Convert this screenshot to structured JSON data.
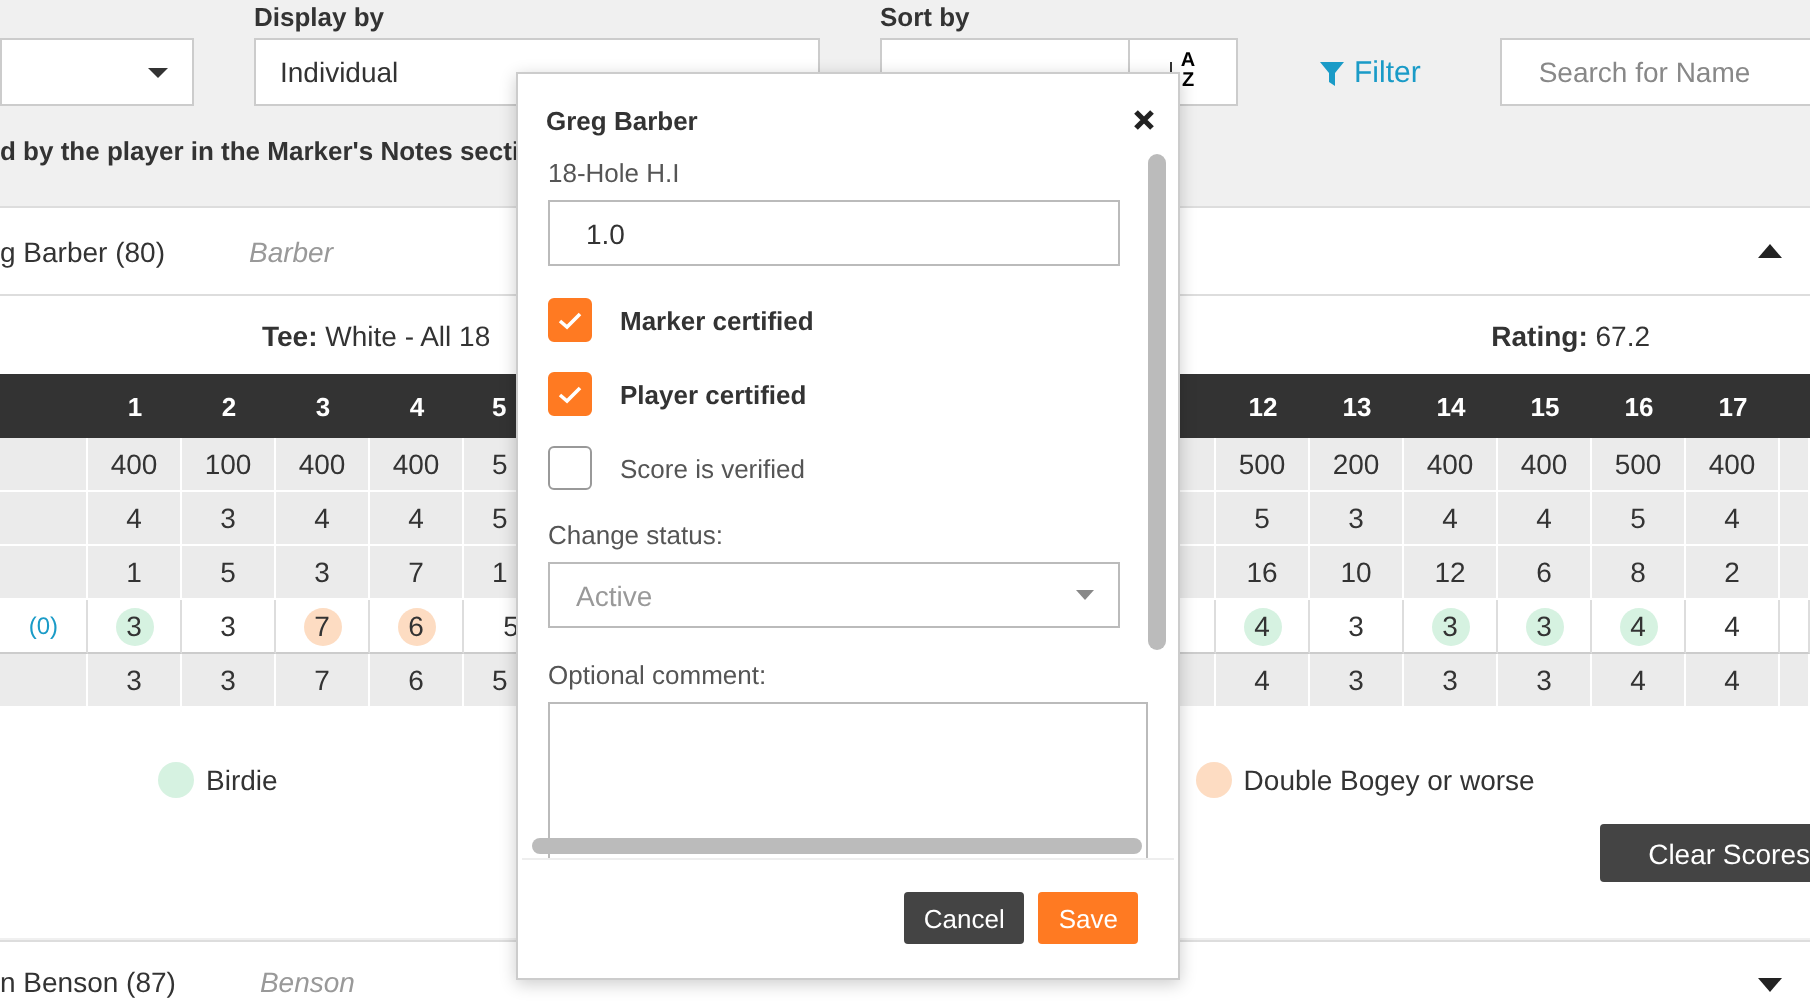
{
  "display_by": {
    "label": "Display by",
    "value": "Individual"
  },
  "sort_by": {
    "label": "Sort by",
    "order_top": "A",
    "order_bottom": "Z"
  },
  "filter": {
    "label": "Filter"
  },
  "search": {
    "placeholder": "Search for Name"
  },
  "note": "d by the player in the Marker's Notes secti",
  "players": [
    {
      "name": "g Barber (80)",
      "short_name": "Barber",
      "expanded": true
    },
    {
      "name": "n Benson (87)",
      "short_name": "Benson",
      "expanded": false
    }
  ],
  "scorecard": {
    "tee_label": "Tee:",
    "tee": "White - All 18",
    "rating_label": "Rating:",
    "rating": "67.2",
    "score_total": "(0)",
    "front_holes": [
      {
        "hole": "1",
        "yards": "400",
        "par": "4",
        "index": "1",
        "score": "3",
        "net": "3",
        "color": "#d6f2e1"
      },
      {
        "hole": "2",
        "yards": "100",
        "par": "3",
        "index": "5",
        "score": "3",
        "net": "3"
      },
      {
        "hole": "3",
        "yards": "400",
        "par": "4",
        "index": "3",
        "score": "7",
        "net": "7",
        "color": "#fddcc2"
      },
      {
        "hole": "4",
        "yards": "400",
        "par": "4",
        "index": "7",
        "score": "6",
        "net": "6",
        "color": "#fddcc2"
      },
      {
        "hole": "5",
        "yards": "5",
        "par": "5",
        "index": "1",
        "score": "5",
        "net": "5"
      }
    ],
    "back_holes": [
      {
        "hole": "12",
        "yards": "500",
        "par": "5",
        "index": "16",
        "score": "4",
        "net": "4",
        "color": "#d6f2e1"
      },
      {
        "hole": "13",
        "yards": "200",
        "par": "3",
        "index": "10",
        "score": "3",
        "net": "3"
      },
      {
        "hole": "14",
        "yards": "400",
        "par": "4",
        "index": "12",
        "score": "3",
        "net": "3",
        "color": "#d6f2e1"
      },
      {
        "hole": "15",
        "yards": "400",
        "par": "4",
        "index": "6",
        "score": "3",
        "net": "3",
        "color": "#d6f2e1"
      },
      {
        "hole": "16",
        "yards": "500",
        "par": "5",
        "index": "8",
        "score": "4",
        "net": "4",
        "color": "#d6f2e1"
      },
      {
        "hole": "17",
        "yards": "400",
        "par": "4",
        "index": "2",
        "score": "4",
        "net": "4"
      }
    ]
  },
  "legend": [
    {
      "label": "Birdie",
      "color": "#d6f2e1"
    },
    {
      "label": "Double Bogey or worse",
      "color": "#fddcc2"
    }
  ],
  "clear_button": "Clear Scores",
  "modal": {
    "title": "Greg Barber",
    "hi_label": "18-Hole H.I",
    "hi_value": "1.0",
    "checks": [
      {
        "label": "Marker certified",
        "checked": true
      },
      {
        "label": "Player certified",
        "checked": true
      },
      {
        "label": "Score is verified",
        "checked": false
      }
    ],
    "status_label": "Change status:",
    "status_value": "Active",
    "comment_label": "Optional comment:",
    "buttons": [
      {
        "label": "Cancel",
        "kind": "secondary"
      },
      {
        "label": "Save",
        "kind": "primary"
      }
    ]
  }
}
